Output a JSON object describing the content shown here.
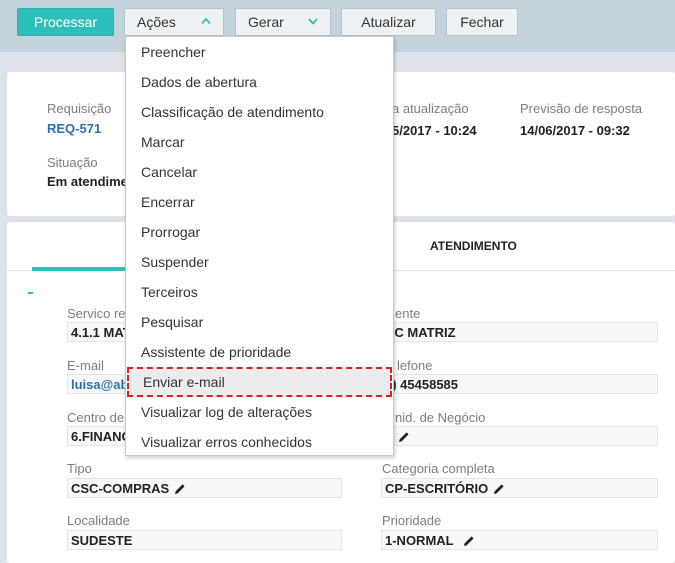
{
  "toolbar": {
    "process_label": "Processar",
    "actions_label": "Ações",
    "generate_label": "Gerar",
    "refresh_label": "Atualizar",
    "close_label": "Fechar",
    "accent_color": "#2fbfbb"
  },
  "summary": {
    "request_label": "Requisição",
    "request_value": "REQ-571",
    "last_update_label": "a atualização",
    "last_update_value": "5/2017 - 10:24",
    "forecast_label": "Previsão de resposta",
    "forecast_value": "14/06/2017 - 09:32",
    "status_label": "Situação",
    "status_value": "Em atendime"
  },
  "tabs": {
    "attendance_label": "ATENDIMENTO"
  },
  "form": {
    "service_label": "Servico req",
    "service_value": "4.1.1 MAT",
    "client_label": "ente",
    "client_value": "BC MATRIZ",
    "email_label": "E-mail",
    "email_value": "luisa@ab",
    "phone_label": "lefone",
    "phone_value": "1) 45458585",
    "cost_center_label": "Centro de C",
    "cost_center_value": "6.FINANC",
    "business_unit_label": "nid. de Negócio",
    "type_label": "Tipo",
    "type_value": "CSC-COMPRAS",
    "category_label": "Categoria completa",
    "category_value": "CP-ESCRITÓRIO",
    "location_label": "Localidade",
    "location_value": "SUDESTE",
    "priority_label": "Prioridade",
    "priority_value": "1-NORMAL"
  },
  "menu": {
    "items": [
      "Preencher",
      "Dados de abertura",
      "Classificação de atendimento",
      "Marcar",
      "Cancelar",
      "Encerrar",
      "Prorrogar",
      "Suspender",
      "Terceiros",
      "Pesquisar",
      "Assistente de prioridade",
      "Enviar e-mail",
      "Visualizar log de alterações",
      "Visualizar erros conhecidos"
    ],
    "highlight_color": "#e01f1f"
  }
}
